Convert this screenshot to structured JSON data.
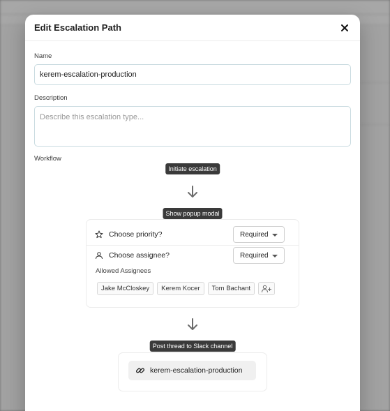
{
  "modal": {
    "title": "Edit Escalation Path",
    "close_icon": "close-icon"
  },
  "form": {
    "name_label": "Name",
    "name_value": "kerem-escalation-production",
    "description_label": "Description",
    "description_placeholder": "Describe this escalation type...",
    "workflow_label": "Workflow"
  },
  "workflow": {
    "step1": "Initiate escalation",
    "step2": "Show popup modal",
    "priority": {
      "label": "Choose priority?",
      "value": "Required",
      "icon": "star-icon"
    },
    "assignee": {
      "label": "Choose assignee?",
      "value": "Required",
      "icon": "user-icon"
    },
    "allowed_label": "Allowed Assignees",
    "assignees": [
      "Jake McCloskey",
      "Kerem Kocer",
      "Tom Bachant"
    ],
    "add_assignee_icon": "add-user-icon",
    "step3": "Post thread to Slack channel",
    "slack_channel": "kerem-escalation-production",
    "slack_icon": "link-icon"
  },
  "colors": {
    "pill_bg": "#3a3a3a",
    "input_border": "#c9dbe0",
    "overlay": "#8f8f8f"
  }
}
